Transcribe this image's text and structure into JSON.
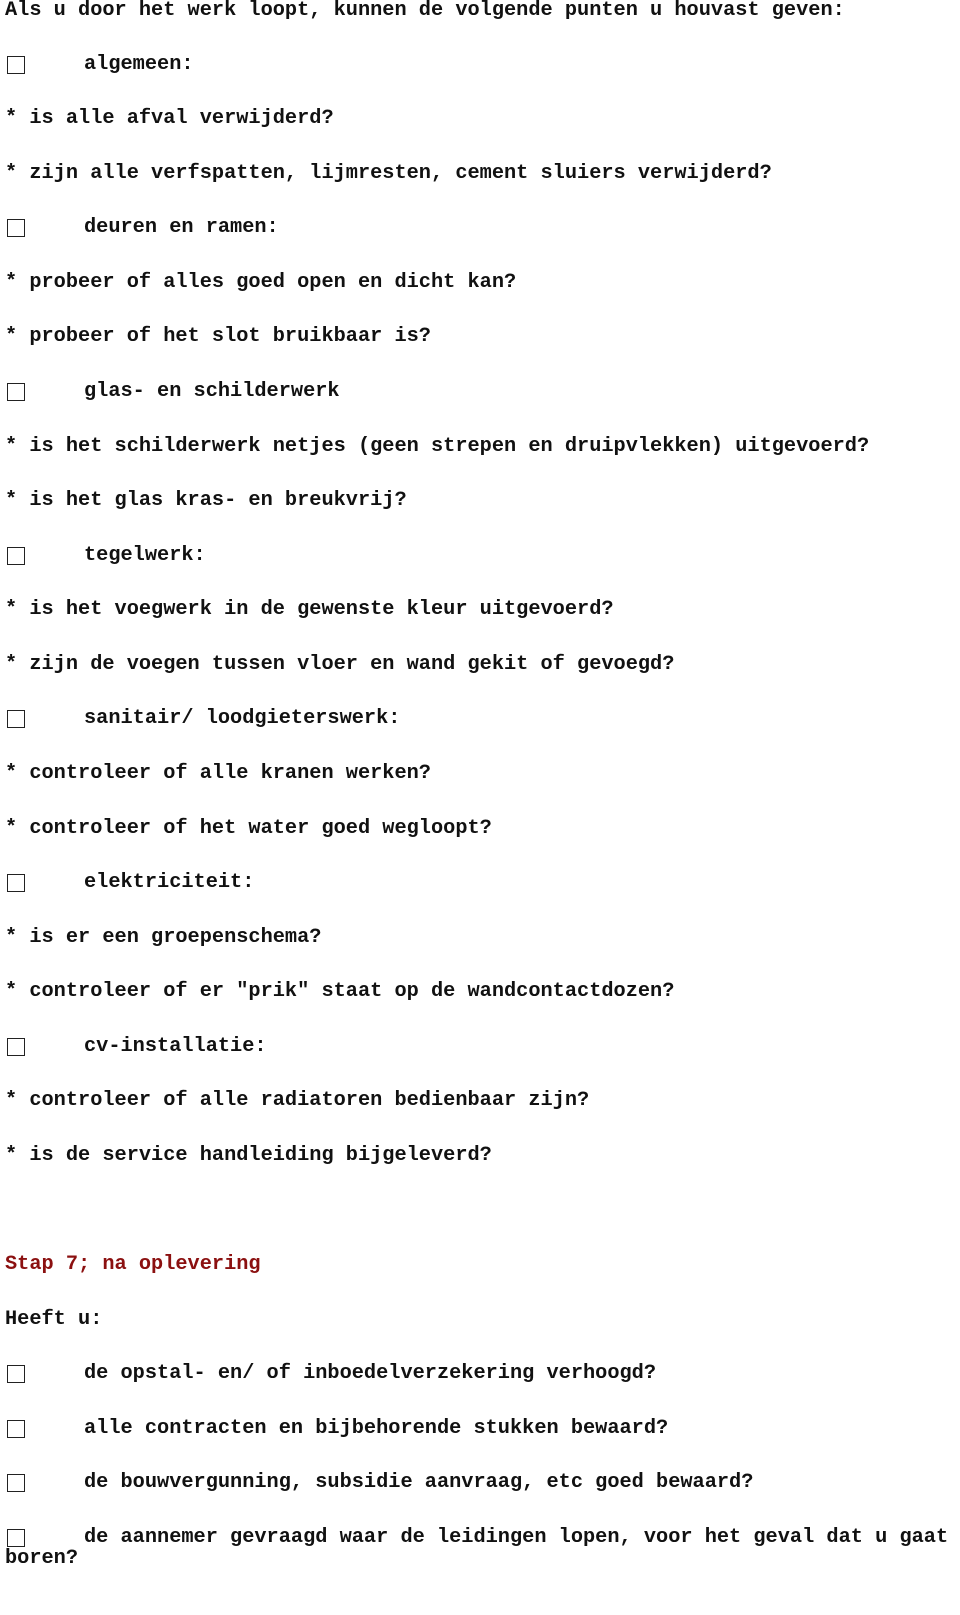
{
  "intro": "Als u door het werk loopt, kunnen de volgende punten u houvast geven:",
  "sections": [
    {
      "checkbox": "algemeen:",
      "checked": false,
      "items": [
        "* is alle afval verwijderd?",
        "* zijn alle verfspatten, lijmresten, cement sluiers verwijderd?"
      ]
    },
    {
      "checkbox": "deuren en ramen:",
      "checked": false,
      "items": [
        "* probeer of alles goed open en dicht kan?",
        "* probeer of het slot bruikbaar is?"
      ]
    },
    {
      "checkbox": "glas- en schilderwerk",
      "checked": false,
      "items": [
        "* is het schilderwerk netjes (geen strepen en druipvlekken) uitgevoerd?",
        "* is het glas kras- en breukvrij?"
      ]
    },
    {
      "checkbox": "tegelwerk:",
      "checked": false,
      "items": [
        "* is het voegwerk in de gewenste kleur uitgevoerd?",
        "* zijn de voegen tussen vloer en wand gekit of gevoegd?"
      ]
    },
    {
      "checkbox": "sanitair/ loodgieterswerk:",
      "checked": false,
      "items": [
        "* controleer of alle kranen werken?",
        "* controleer of het water goed wegloopt?"
      ]
    },
    {
      "checkbox": "elektriciteit:",
      "checked": false,
      "items": [
        "* is er een groepenschema?",
        "* controleer of er \"prik\" staat op de wandcontactdozen?"
      ]
    },
    {
      "checkbox": "cv-installatie:",
      "checked": false,
      "items": [
        "* controleer of alle radiatoren bedienbaar zijn?",
        "* is de service handleiding bijgeleverd?"
      ]
    }
  ],
  "step7": {
    "heading": "Stap 7; na oplevering",
    "heading_color": "#8b1010",
    "subheading": "Heeft u:",
    "checkboxes": [
      "de opstal- en/ of inboedelverzekering verhoogd?",
      "alle contracten en bijbehorende stukken bewaard?",
      "de bouwvergunning, subsidie aanvraag, etc goed bewaard?",
      "de aannemer gevraagd waar de leidingen lopen, voor het geval dat u gaat"
    ],
    "last_line_wrap": "boren?"
  }
}
